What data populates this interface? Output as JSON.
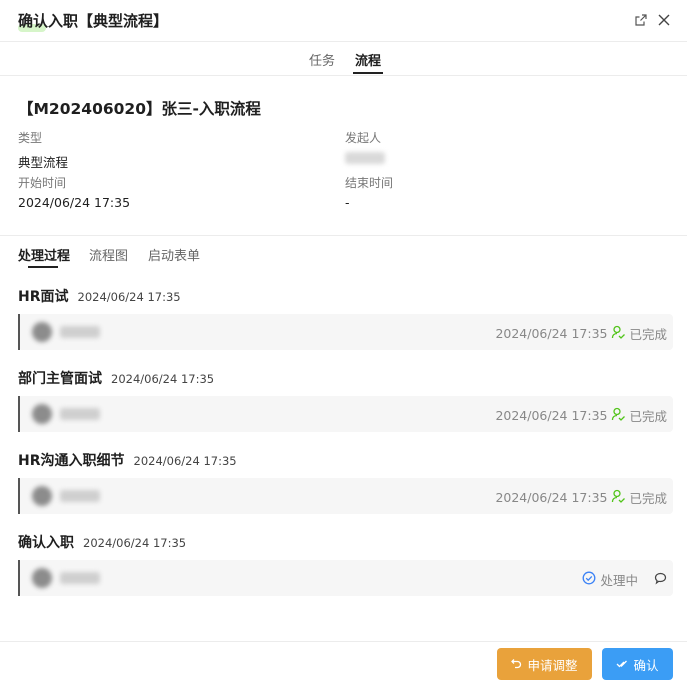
{
  "dialog": {
    "title": "确认入职【典型流程】"
  },
  "top_tabs": [
    {
      "label": "任务",
      "active": false
    },
    {
      "label": "流程",
      "active": true
    }
  ],
  "process": {
    "name": "【M202406020】张三-入职流程",
    "type_label": "类型",
    "type_value": "典型流程",
    "initiator_label": "发起人",
    "start_label": "开始时间",
    "start_value": "2024/06/24 17:35",
    "end_label": "结束时间",
    "end_value": "-"
  },
  "sub_tabs": [
    {
      "label": "处理过程",
      "active": true
    },
    {
      "label": "流程图",
      "active": false
    },
    {
      "label": "启动表单",
      "active": false
    }
  ],
  "steps": [
    {
      "name": "HR面试",
      "time": "2024/06/24 17:35",
      "finish_time": "2024/06/24 17:35",
      "status": "已完成"
    },
    {
      "name": "部门主管面试",
      "time": "2024/06/24 17:35",
      "finish_time": "2024/06/24 17:35",
      "status": "已完成"
    },
    {
      "name": "HR沟通入职细节",
      "time": "2024/06/24 17:35",
      "finish_time": "2024/06/24 17:35",
      "status": "已完成"
    },
    {
      "name": "确认入职",
      "time": "2024/06/24 17:35",
      "finish_time": "",
      "status": "处理中"
    }
  ],
  "footer": {
    "adjust_label": "申请调整",
    "confirm_label": "确认"
  },
  "colors": {
    "done_icon": "#52c41a",
    "processing_icon": "#3b82f6",
    "adjust_button": "#e9a23b",
    "confirm_button": "#3b9df5"
  },
  "icons": {
    "external": "external-link-icon",
    "close": "close-icon",
    "done": "user-check-icon",
    "processing": "check-circle-icon",
    "comment": "comment-icon",
    "undo": "undo-icon",
    "confirm": "double-check-icon"
  }
}
